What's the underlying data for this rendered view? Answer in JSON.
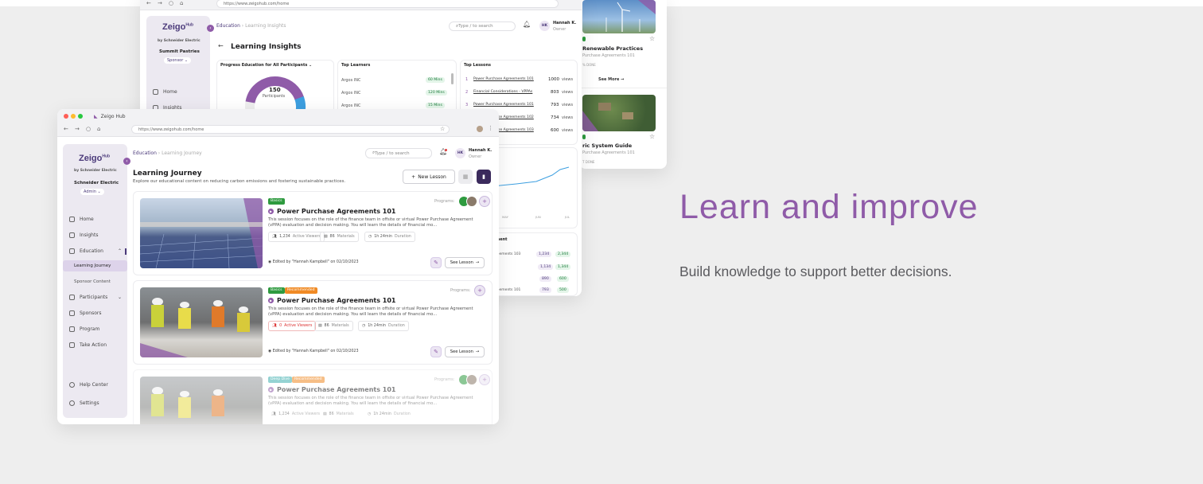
{
  "hero": {
    "headline": "Learn and improve",
    "subtext": "Build knowledge to support better decisions."
  },
  "back_window": {
    "url": "https://www.zeigohub.com/home",
    "breadcrumb": [
      "Education",
      "Learning Insights"
    ],
    "search_placeholder": "Type / to search",
    "user": {
      "initials": "HK",
      "name": "Hannah K.",
      "role": "Owner"
    },
    "sidebar": {
      "brand": "Zeigo",
      "brand_sub": "Hub",
      "by": "by Schneider Electric",
      "org": "Summit Pastries",
      "role": "Sponsor",
      "items": [
        "Home",
        "Insights"
      ]
    },
    "page_title": "Learning Insights",
    "progress_panel": {
      "title": "Progress Education for All Participants",
      "center_value": "150",
      "center_label": "Participants"
    },
    "top_learners": {
      "title": "Top Learners",
      "rows": [
        {
          "name": "Argos INC",
          "value": "60 Mins"
        },
        {
          "name": "Argos INC",
          "value": "120 Mins"
        },
        {
          "name": "Argos INC",
          "value": "15 Mins"
        }
      ]
    },
    "top_lessons": {
      "title": "Top Lessons",
      "rows": [
        {
          "rank": "1",
          "name": "Power Purchase Agreements 101",
          "views": "1000",
          "unit": "views"
        },
        {
          "rank": "2",
          "name": "Financial Considerations - VPPAs",
          "views": "803",
          "unit": "views"
        },
        {
          "rank": "3",
          "name": "Power Purchase Agreements 101",
          "views": "793",
          "unit": "views"
        },
        {
          "rank": "4",
          "name": "Power Purchase Agreements 102",
          "views": "734",
          "unit": "views"
        },
        {
          "rank": "5",
          "name": "Power Purchase Agreements 103",
          "views": "600",
          "unit": "views"
        }
      ]
    },
    "chart_axis": [
      "MAY",
      "JUN",
      "JUL"
    ],
    "engagement_title": "ment",
    "engagement_rows": [
      {
        "name": "reements 103",
        "a": "1,234",
        "b": "2,344"
      },
      {
        "name": "s",
        "a": "1,134",
        "b": "1,344"
      },
      {
        "name": "",
        "a": "890",
        "b": "600"
      },
      {
        "name": "reements 101",
        "a": "793",
        "b": "500"
      }
    ]
  },
  "right_window": {
    "card1": {
      "title": "Renewable Practices",
      "subtitle": "Purchase Agreements 101",
      "meta": "% DONE",
      "see_more": "See More"
    },
    "card2": {
      "title": "ric System Guide",
      "subtitle": "Purchase Agreements 101",
      "meta": "T DONE"
    }
  },
  "front_window": {
    "tab_label": "Zeigo Hub",
    "url": "https://www.zeigohub.com/home",
    "breadcrumb": [
      "Education",
      "Learning Journey"
    ],
    "search_placeholder": "Type / to search",
    "user": {
      "initials": "HK",
      "name": "Hannah K.",
      "role": "Owner"
    },
    "sidebar": {
      "brand": "Zeigo",
      "brand_sub": "Hub",
      "by": "by Schneider Electric",
      "org": "Schneider Electric",
      "role": "Admin",
      "items": {
        "home": "Home",
        "insights": "Insights",
        "education": "Education",
        "learning_journey": "Learning Journey",
        "sponsor_content": "Sponsor Content",
        "participants": "Participants",
        "sponsors": "Sponsors",
        "program": "Program",
        "take_action": "Take Action",
        "help_center": "Help Center",
        "settings": "Settings"
      }
    },
    "page_title": "Learning Journey",
    "page_subtitle": "Explore our educational content on reducing carbon emissions and fostering sustainable practices.",
    "new_lesson": "New Lesson",
    "lessons": [
      {
        "badges": [
          "Basics"
        ],
        "title": "Power Purchase Agreements 101",
        "description": "This session focuses on the role of the finance team in offsite or virtual Power Purchase Agreement (vPPA) evaluation and decision making. You will learn the details of financial mo...",
        "viewers": "1,234",
        "viewers_label": "Active Viewers",
        "materials": "86",
        "materials_label": "Materials",
        "duration": "1h 24min",
        "duration_label": "Duration",
        "programs_label": "Programs:",
        "edited": "Edited by \"Hannah Kampbell\" on 02/10/2023",
        "see_lesson": "See Lesson"
      },
      {
        "badges": [
          "Basics",
          "Recommended"
        ],
        "title": "Power Purchase Agreements 101",
        "description": "This session focuses on the role of the finance team in offsite or virtual Power Purchase Agreement (vPPA) evaluation and decision making. You will learn the details of financial mo...",
        "viewers": "0",
        "viewers_label": "Active Viewers",
        "materials": "86",
        "materials_label": "Materials",
        "duration": "1h 24min",
        "duration_label": "Duration",
        "programs_label": "Programs:",
        "edited": "Edited by \"Hannah Kampbell\" on 02/10/2023",
        "see_lesson": "See Lesson"
      },
      {
        "badges": [
          "Deep Dive",
          "Recommended"
        ],
        "title": "Power Purchase Agreements 101",
        "description": "This session focuses on the role of the finance team in offsite or virtual Power Purchase Agreement (vPPA) evaluation and decision making. You will learn the details of financial mo...",
        "viewers": "1,234",
        "viewers_label": "Active Viewers",
        "materials": "86",
        "materials_label": "Materials",
        "duration": "1h 24min",
        "duration_label": "Duration",
        "programs_label": "Programs:"
      }
    ],
    "colors": {
      "brand": "#8f5ba8",
      "basics": "#2e9a3f",
      "recommended": "#f08a24",
      "deep_dive": "#3fb0b0"
    }
  }
}
